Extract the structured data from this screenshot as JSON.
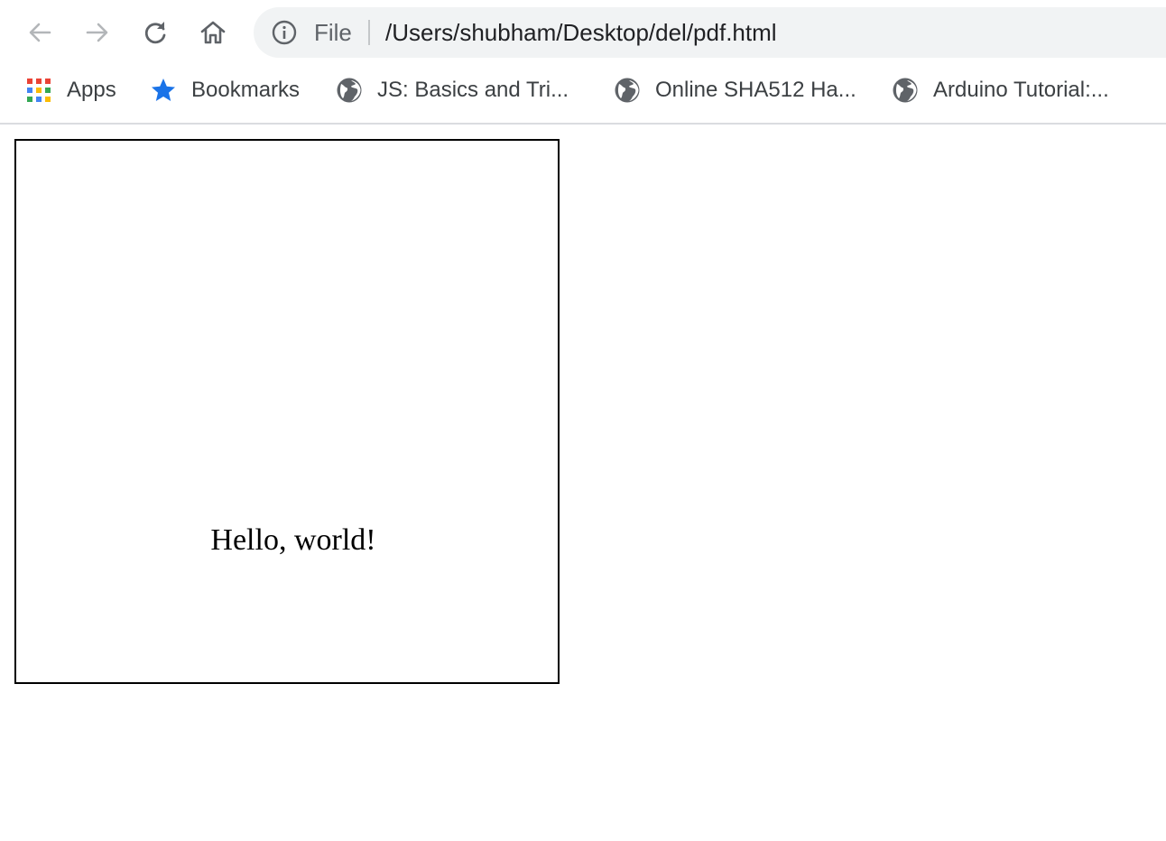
{
  "toolbar": {
    "back_icon": "arrow-left-icon",
    "forward_icon": "arrow-right-icon",
    "reload_icon": "reload-icon",
    "home_icon": "home-icon"
  },
  "omnibox": {
    "info_icon": "info-icon",
    "scheme_label": "File",
    "url": "/Users/shubham/Desktop/del/pdf.html"
  },
  "bookmarks": {
    "items": [
      {
        "label": "Apps",
        "icon": "apps-grid-icon"
      },
      {
        "label": "Bookmarks",
        "icon": "star-icon"
      },
      {
        "label": "JS: Basics and Tri...",
        "icon": "globe-icon"
      },
      {
        "label": "Online SHA512 Ha...",
        "icon": "globe-icon"
      },
      {
        "label": "Arduino Tutorial:...",
        "icon": "globe-icon"
      }
    ]
  },
  "page": {
    "content_text": "Hello, world!"
  },
  "colors": {
    "omnibox_bg": "#f1f3f4",
    "star_blue": "#1a73e8",
    "icon_gray": "#5f6368",
    "apps_red": "#ea4335",
    "apps_blue": "#4285f4",
    "apps_yellow": "#fbbc04",
    "apps_green": "#34a853"
  }
}
